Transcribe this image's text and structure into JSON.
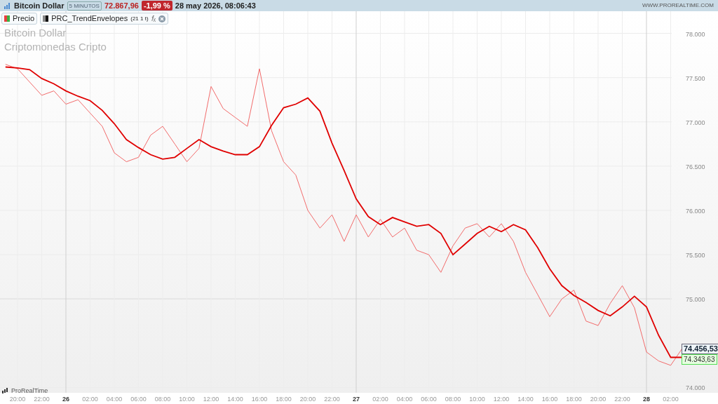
{
  "top_bar": {
    "instrument": "Bitcoin Dollar",
    "timeframe": "5 MINUTOS",
    "price": "72.867,96",
    "change": "-1,99 %",
    "datetime": "28 may 2026, 08:06:43",
    "website": "WWW.PROREALTIME.COM"
  },
  "legend": [
    {
      "kind": "price"
    },
    {
      "kind": "indicator",
      "params": "(21 1 t)",
      "formula_icon": "𝑓ₓ"
    }
  ],
  "chart_title": [
    "Bitcoin Dollar",
    "Criptomonedas  Cripto"
  ],
  "brand": "ProRealTime",
  "price_labels": [
    {
      "kind": "last",
      "text": "74.456,53"
    },
    {
      "kind": "indicator",
      "text": "74.343,63"
    }
  ],
  "chart_data": {
    "type": "line",
    "ylim": [
      73940,
      78250
    ],
    "categories": [
      null,
      "20:00",
      null,
      "22:00",
      null,
      "26",
      null,
      "02:00",
      null,
      "04:00",
      null,
      "06:00",
      null,
      "08:00",
      null,
      "10:00",
      null,
      "12:00",
      null,
      "14:00",
      null,
      "16:00",
      null,
      "18:00",
      null,
      "20:00",
      null,
      "22:00",
      null,
      "27",
      null,
      "02:00",
      null,
      "04:00",
      null,
      "06:00",
      null,
      "08:00",
      null,
      "10:00",
      null,
      "12:00",
      null,
      "14:00",
      null,
      "16:00",
      null,
      "18:00",
      null,
      "20:00",
      null,
      "22:00",
      null,
      "28",
      null,
      "02:00",
      null,
      null,
      null
    ],
    "yticks": [
      {
        "value": 78000,
        "label": "78.000"
      },
      {
        "value": 77500,
        "label": "77.500"
      },
      {
        "value": 77000,
        "label": "77.000"
      },
      {
        "value": 76500,
        "label": "76.500"
      },
      {
        "value": 76000,
        "label": "76.000"
      },
      {
        "value": 75500,
        "label": "75.500"
      },
      {
        "value": 75000,
        "label": "75.000"
      },
      {
        "value": 74000,
        "label": "74.000"
      }
    ],
    "series": [
      {
        "name": "Precio",
        "color": "#f26b6b",
        "values": [
          77650,
          77600,
          77450,
          77300,
          77350,
          77200,
          77250,
          77100,
          76950,
          76650,
          76550,
          76600,
          76850,
          76950,
          76750,
          76550,
          76700,
          77400,
          77150,
          77050,
          76950,
          77600,
          76900,
          76550,
          76400,
          76000,
          75800,
          75950,
          75650,
          75950,
          75700,
          75900,
          75700,
          75800,
          75550,
          75500,
          75300,
          75600,
          75800,
          75850,
          75700,
          75850,
          75650,
          75300,
          75050,
          74800,
          75000,
          75100,
          74750,
          74700,
          74950,
          75150,
          74900,
          74400,
          74300,
          74250,
          74450,
          null,
          null
        ]
      },
      {
        "name": "PRC_TrendEnvelopes",
        "color": "#e00000",
        "values": [
          77620,
          77610,
          77590,
          77490,
          77430,
          77350,
          77290,
          77240,
          77130,
          76980,
          76800,
          76710,
          76630,
          76580,
          76600,
          76700,
          76800,
          76720,
          76670,
          76630,
          76630,
          76720,
          76960,
          77160,
          77200,
          77270,
          77120,
          76760,
          76450,
          76130,
          75930,
          75840,
          75920,
          75870,
          75820,
          75840,
          75740,
          75500,
          75620,
          75740,
          75820,
          75760,
          75840,
          75780,
          75580,
          75340,
          75150,
          75040,
          74960,
          74870,
          74810,
          74910,
          75030,
          74910,
          74590,
          74340,
          74340,
          null,
          null
        ]
      }
    ],
    "grid": true,
    "ref_lines": [
      {
        "axis": "y",
        "value": 75000
      }
    ]
  }
}
